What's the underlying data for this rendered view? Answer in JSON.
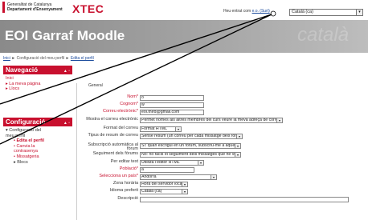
{
  "header": {
    "gencat_line1": "Generalitat de Catalunya",
    "gencat_line2": "Departament d'Ensenyament",
    "xtec_logo": "XTEC",
    "login_prefix": "Heu entrat com",
    "login_user": "e.o. (Surt)",
    "language_selected": "Català (ca)"
  },
  "site": {
    "title": "EOI Garraf Moodle",
    "banner_text": "català"
  },
  "breadcrumb": {
    "home": "Inici",
    "sep": "►",
    "item1": "Configuració del meu perfil",
    "item2": "Edita el perfil"
  },
  "nav_block": {
    "title": "Navegació",
    "items": [
      "Inici",
      "▸ La meva pàgina",
      "▸ Llocs"
    ]
  },
  "conf_block": {
    "title": "Configuració",
    "items": [
      {
        "label": "▾ Configuració del",
        "cls": "top"
      },
      {
        "label": "  meu perfil",
        "cls": "top"
      },
      {
        "label": "• Edita el perfil",
        "cls": "sub bold"
      },
      {
        "label": "• Canvia la",
        "cls": "sub"
      },
      {
        "label": "  contrasenya",
        "cls": "sub"
      },
      {
        "label": "• Missatgeria",
        "cls": "sub"
      },
      {
        "label": "▸ Blocs",
        "cls": "sub black"
      }
    ]
  },
  "form": {
    "section_title": "General",
    "rows": [
      {
        "label": "Nom*",
        "value": "o",
        "req": true,
        "w": 80,
        "dd": false
      },
      {
        "label": "Cognom*",
        "value": "w",
        "req": true,
        "w": 80,
        "dd": false
      },
      {
        "label": "Correu electrònic*",
        "value": "eoi.third@gmail.com",
        "req": true,
        "w": 80,
        "dd": false
      },
      {
        "label": "Mostra el correu electrònic",
        "value": "Permet només als altres membres del curs veure la meva adreça de correu",
        "req": false,
        "w": 178,
        "dd": true
      },
      {
        "label": "Format del correu",
        "value": "Format HTML",
        "req": false,
        "w": 52,
        "dd": true
      },
      {
        "label": "Tipus de resum de correu",
        "value": "Sense resum (un correu per cada missatge dels fòrums)",
        "req": false,
        "w": 128,
        "dd": true
      },
      {
        "label": "Subscripció automàtica al fòrum",
        "value": "Sí: quan escrigui en un fòrum, subscriu-me a aquest fòrum",
        "req": false,
        "w": 126,
        "dd": true
      },
      {
        "label": "Seguiment dels fòrums",
        "value": "No: no facis el seguiment dels missatges que he vist",
        "req": false,
        "w": 126,
        "dd": true
      },
      {
        "label": "Per editar text",
        "value": "Utilitza l'editor HTML",
        "req": false,
        "w": 80,
        "dd": true
      },
      {
        "label": "Població*",
        "value": "a",
        "req": true,
        "w": 68,
        "dd": false
      },
      {
        "label": "Selecciona un país*",
        "value": "Andorra",
        "req": true,
        "w": 96,
        "dd": true
      },
      {
        "label": "Zona horària",
        "value": "Hora del servidor local",
        "req": false,
        "w": 60,
        "dd": true
      },
      {
        "label": "Idioma preferit",
        "value": "Català (ca)",
        "req": false,
        "w": 60,
        "dd": true
      },
      {
        "label": "Descripció",
        "value": "",
        "req": false,
        "w": 260,
        "dd": false
      }
    ]
  }
}
